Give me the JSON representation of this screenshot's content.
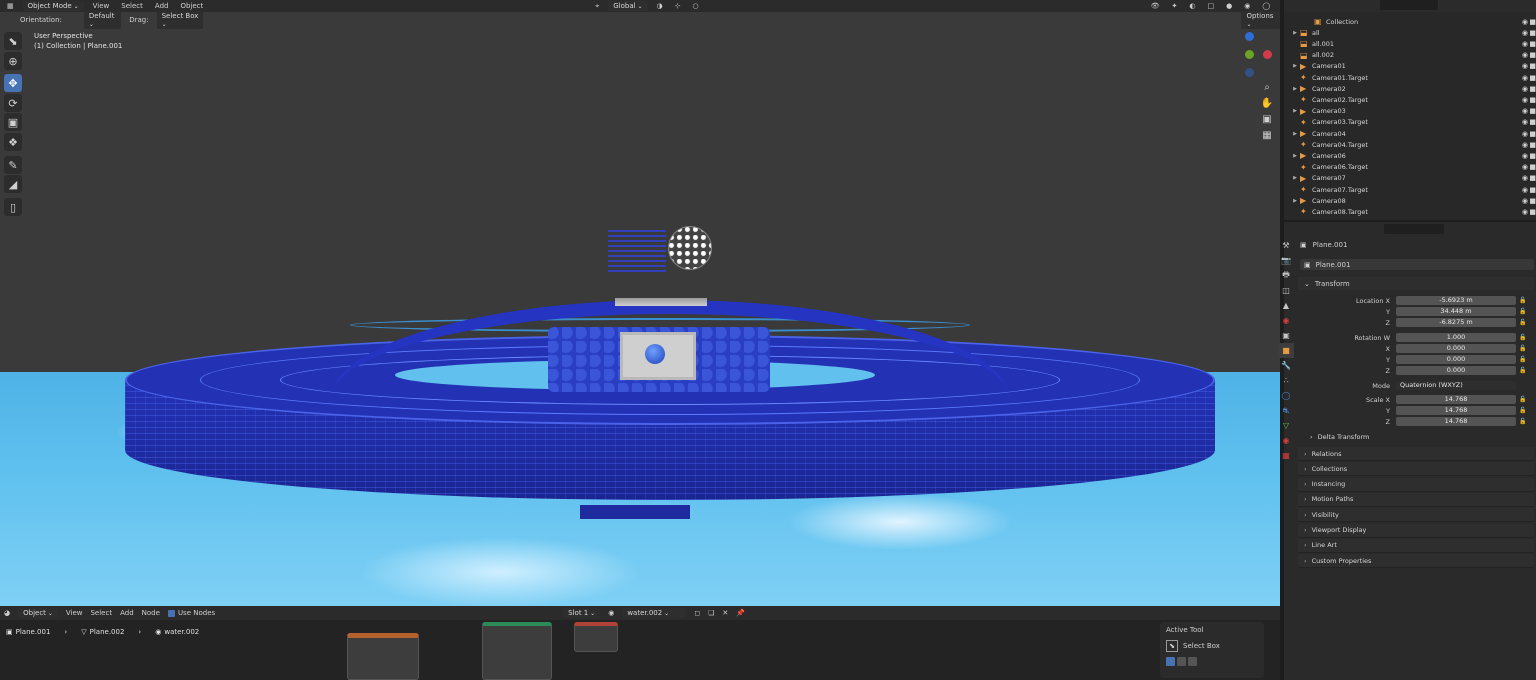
{
  "viewport": {
    "header": {
      "mode": "Object Mode",
      "menus": [
        "View",
        "Select",
        "Add",
        "Object"
      ],
      "transform_orientation": "Global",
      "options": "Options"
    },
    "subheader": {
      "orientation_label": "Orientation:",
      "orientation_value": "Default",
      "drag_label": "Drag:",
      "drag_value": "Select Box"
    },
    "info_line1": "User Perspective",
    "info_line2": "(1) Collection | Plane.001"
  },
  "node_editor": {
    "type": "Object",
    "menus": [
      "View",
      "Select",
      "Add",
      "Node"
    ],
    "use_nodes_label": "Use Nodes",
    "slot": "Slot 1",
    "material": "water.002",
    "breadcrumb": [
      "Plane.001",
      "Plane.002",
      "water.002"
    ],
    "active_tool": {
      "title": "Active Tool",
      "tool": "Select Box"
    }
  },
  "outliner": {
    "items": [
      {
        "name": "Collection",
        "arrow": false,
        "icon": "collection"
      },
      {
        "name": "all",
        "arrow": true,
        "icon": "object"
      },
      {
        "name": "all.001",
        "arrow": false,
        "icon": "object"
      },
      {
        "name": "all.002",
        "arrow": false,
        "icon": "object"
      },
      {
        "name": "Camera01",
        "arrow": true,
        "icon": "camera"
      },
      {
        "name": "Camera01.Target",
        "arrow": false,
        "icon": "empty"
      },
      {
        "name": "Camera02",
        "arrow": true,
        "icon": "camera"
      },
      {
        "name": "Camera02.Target",
        "arrow": false,
        "icon": "empty"
      },
      {
        "name": "Camera03",
        "arrow": true,
        "icon": "camera"
      },
      {
        "name": "Camera03.Target",
        "arrow": false,
        "icon": "empty"
      },
      {
        "name": "Camera04",
        "arrow": true,
        "icon": "camera"
      },
      {
        "name": "Camera04.Target",
        "arrow": false,
        "icon": "empty"
      },
      {
        "name": "Camera06",
        "arrow": true,
        "icon": "camera"
      },
      {
        "name": "Camera06.Target",
        "arrow": false,
        "icon": "empty"
      },
      {
        "name": "Camera07",
        "arrow": true,
        "icon": "camera"
      },
      {
        "name": "Camera07.Target",
        "arrow": false,
        "icon": "empty"
      },
      {
        "name": "Camera08",
        "arrow": true,
        "icon": "camera"
      },
      {
        "name": "Camera08.Target",
        "arrow": false,
        "icon": "empty"
      }
    ]
  },
  "properties": {
    "object_name": "Plane.001",
    "object_field": "Plane.001",
    "transform_title": "Transform",
    "location": {
      "label": "Location X",
      "x": "-5.6923 m",
      "y": "34.448 m",
      "z": "-6.8275 m"
    },
    "rotation": {
      "label": "Rotation W",
      "w": "1.000",
      "x": "0.000",
      "y": "0.000",
      "z": "0.000"
    },
    "mode_label": "Mode",
    "mode_value": "Quaternion (WXYZ)",
    "scale": {
      "label": "Scale X",
      "x": "14.768",
      "y": "14.768",
      "z": "14.768"
    },
    "axis": {
      "x": "X",
      "y": "Y",
      "z": "Z",
      "w": "W"
    },
    "delta_transform": "Delta Transform",
    "sections": [
      "Relations",
      "Collections",
      "Instancing",
      "Motion Paths",
      "Visibility",
      "Viewport Display",
      "Line Art",
      "Custom Properties"
    ]
  }
}
